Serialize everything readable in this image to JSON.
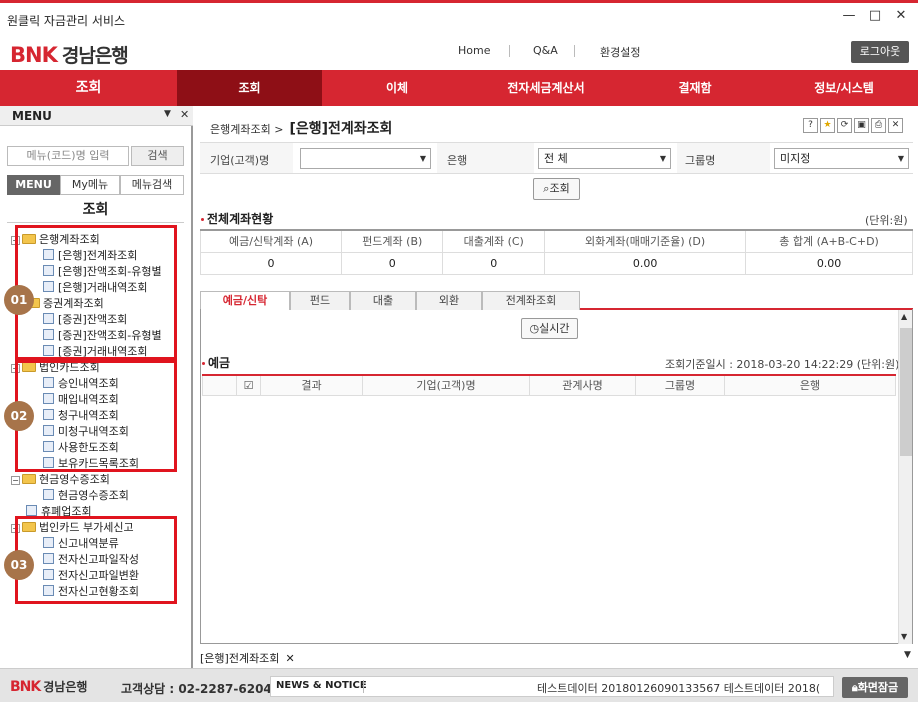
{
  "window": {
    "title": "원클릭 자금관리 서비스",
    "minimize": "—",
    "maximize": "□",
    "close": "✕"
  },
  "brand": {
    "logo_en": "BNK",
    "logo_kr": "경남은행",
    "color": "#d62631"
  },
  "header": {
    "links": [
      "Home",
      "Q&A",
      "환경설정"
    ],
    "logout": "로그아웃"
  },
  "nav": {
    "home": "조회",
    "items": [
      "조회",
      "이체",
      "전자세금계산서",
      "결재함",
      "정보/시스템"
    ]
  },
  "sidebar": {
    "title": "MENU",
    "search_placeholder": "메뉴(코드)명 입력",
    "search_button": "검색",
    "tabs": [
      "MENU",
      "My메뉴",
      "메뉴검색"
    ],
    "section_title": "조회",
    "tree": [
      {
        "type": "folder",
        "label": "은행계좌조회"
      },
      {
        "type": "doc",
        "label": "[은행]전계좌조회"
      },
      {
        "type": "doc",
        "label": "[은행]잔액조회-유형별"
      },
      {
        "type": "doc",
        "label": "[은행]거래내역조회"
      },
      {
        "type": "folder",
        "label": "증권계좌조회"
      },
      {
        "type": "doc",
        "label": "[증권]잔액조회"
      },
      {
        "type": "doc",
        "label": "[증권]잔액조회-유형별"
      },
      {
        "type": "doc",
        "label": "[증권]거래내역조회"
      },
      {
        "type": "folder",
        "label": "법인카드조회"
      },
      {
        "type": "doc",
        "label": "승인내역조회"
      },
      {
        "type": "doc",
        "label": "매입내역조회"
      },
      {
        "type": "doc",
        "label": "청구내역조회"
      },
      {
        "type": "doc",
        "label": "미청구내역조회"
      },
      {
        "type": "doc",
        "label": "사용한도조회"
      },
      {
        "type": "doc",
        "label": "보유카드목록조회"
      },
      {
        "type": "folder",
        "label": "현금영수증조회"
      },
      {
        "type": "doc",
        "label": "현금영수증조회"
      },
      {
        "type": "doc",
        "label": "휴폐업조회"
      },
      {
        "type": "folder",
        "label": "법인카드 부가세신고"
      },
      {
        "type": "doc",
        "label": "신고내역분류"
      },
      {
        "type": "doc",
        "label": "전자신고파일작성"
      },
      {
        "type": "doc",
        "label": "전자신고파일변환"
      },
      {
        "type": "doc",
        "label": "전자신고현황조회"
      }
    ],
    "badges": [
      "01",
      "02",
      "03"
    ]
  },
  "content": {
    "breadcrumb": "은행계좌조회 >",
    "page_title": "[은행]전계좌조회",
    "toolbar_icons": [
      "?",
      "★",
      "⟳",
      "▣",
      "⎙",
      "✕"
    ],
    "filter": {
      "company_label": "기업(고객)명",
      "company_value": "",
      "bank_label": "은행",
      "bank_value": "전      체",
      "group_label": "그룹명",
      "group_value": "미지정"
    },
    "search_button": "조회",
    "summary": {
      "title": "전체계좌현황",
      "unit": "(단위:원)",
      "headers": [
        "예금/신탁계좌 (A)",
        "펀드계좌 (B)",
        "대출계좌 (C)",
        "외화계좌(매매기준율) (D)",
        "총 합계 (A+B-C+D)"
      ],
      "values": [
        "0",
        "0",
        "0",
        "0.00",
        "0.00"
      ]
    },
    "tabs": [
      "예금/신탁",
      "펀드",
      "대출",
      "외환",
      "전계좌조회"
    ],
    "realtime_button": "실시간",
    "deposit": {
      "title": "예금",
      "base_time": "조회기준일시 : 2018-03-20 14:22:29  (단위:원)",
      "columns": [
        "",
        "☑",
        "결과",
        "기업(고객)명",
        "관계사명",
        "그룹명",
        "은행"
      ]
    },
    "bottom_tab": "[은행]전계좌조회"
  },
  "footer": {
    "call": "고객상담 : 02-2287-6204",
    "news_label": "NEWS & NOTICE",
    "news_text": "테스트데이터 20180126090133567    테스트데이터 2018(",
    "lock": "화면잠금"
  }
}
